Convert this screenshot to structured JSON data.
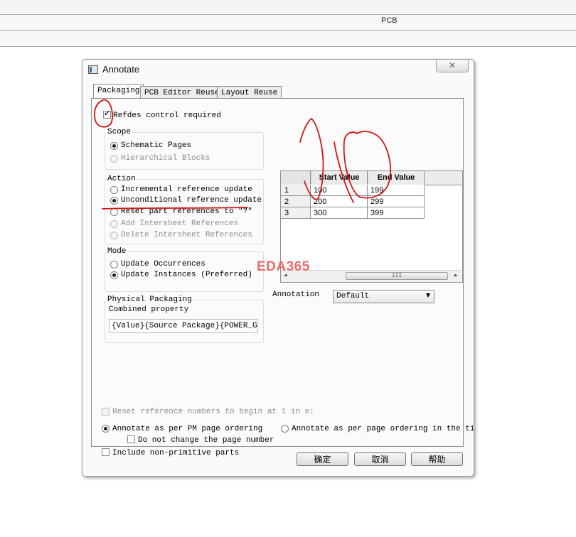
{
  "background": {
    "window_title": "PCB"
  },
  "dialog": {
    "title": "Annotate",
    "close_glyph": "✕",
    "tabs": [
      {
        "label": "Packaging",
        "active": true
      },
      {
        "label": "PCB Editor Reuse",
        "active": false
      },
      {
        "label": "Layout Reuse",
        "active": false
      }
    ],
    "refdes_control": {
      "label": "Refdes control required",
      "checked": true
    },
    "scope": {
      "title": "Scope",
      "options": [
        {
          "label": "Schematic Pages",
          "selected": true,
          "enabled": true
        },
        {
          "label": "Hierarchical Blocks",
          "selected": false,
          "enabled": false
        }
      ]
    },
    "action": {
      "title": "Action",
      "options": [
        {
          "label": "Incremental reference update",
          "selected": false,
          "enabled": true
        },
        {
          "label": "Unconditional reference update",
          "selected": true,
          "enabled": true
        },
        {
          "label": "Reset part references to \"?\"",
          "selected": false,
          "enabled": true
        },
        {
          "label": "Add Intersheet References",
          "selected": false,
          "enabled": false
        },
        {
          "label": "Delete Intersheet References",
          "selected": false,
          "enabled": false
        }
      ]
    },
    "mode": {
      "title": "Mode",
      "options": [
        {
          "label": "Update Occurrences",
          "selected": false,
          "enabled": true
        },
        {
          "label": "Update Instances (Preferred)",
          "selected": true,
          "enabled": true
        }
      ]
    },
    "physical_packaging": {
      "title": "Physical Packaging",
      "combined_label": "Combined property",
      "combined_value": "{Value}{Source Package}{POWER_GROUP}"
    },
    "grid": {
      "columns": [
        "Start Value",
        "End Value"
      ],
      "rows": [
        {
          "index": "1",
          "start": "100",
          "end": "199"
        },
        {
          "index": "2",
          "start": "200",
          "end": "299"
        },
        {
          "index": "3",
          "start": "300",
          "end": "399"
        }
      ],
      "scroll_left": "◂",
      "scroll_right": "▸",
      "scroll_grip": "III"
    },
    "annotation": {
      "label": "Annotation",
      "value": "Default",
      "arrow": "▼"
    },
    "reset_numbers": {
      "label": "Reset reference numbers to begin at 1 in e:",
      "checked": false,
      "enabled": false
    },
    "ordering": {
      "pm_page": {
        "label": "Annotate as per PM page ordering",
        "selected": true
      },
      "page_ordering": {
        "label": "Annotate as per page ordering in the ti",
        "selected": false
      }
    },
    "no_change_page": {
      "label": "Do not change the page number",
      "checked": false
    },
    "include_non_primitive": {
      "label": "Include non-primitive parts",
      "checked": false
    },
    "buttons": {
      "ok": "确定",
      "cancel": "取消",
      "help": "帮助"
    }
  },
  "watermark": "EDA365",
  "colors": {
    "annotation_ink": "#d41414",
    "watermark": "#e96b6b"
  }
}
